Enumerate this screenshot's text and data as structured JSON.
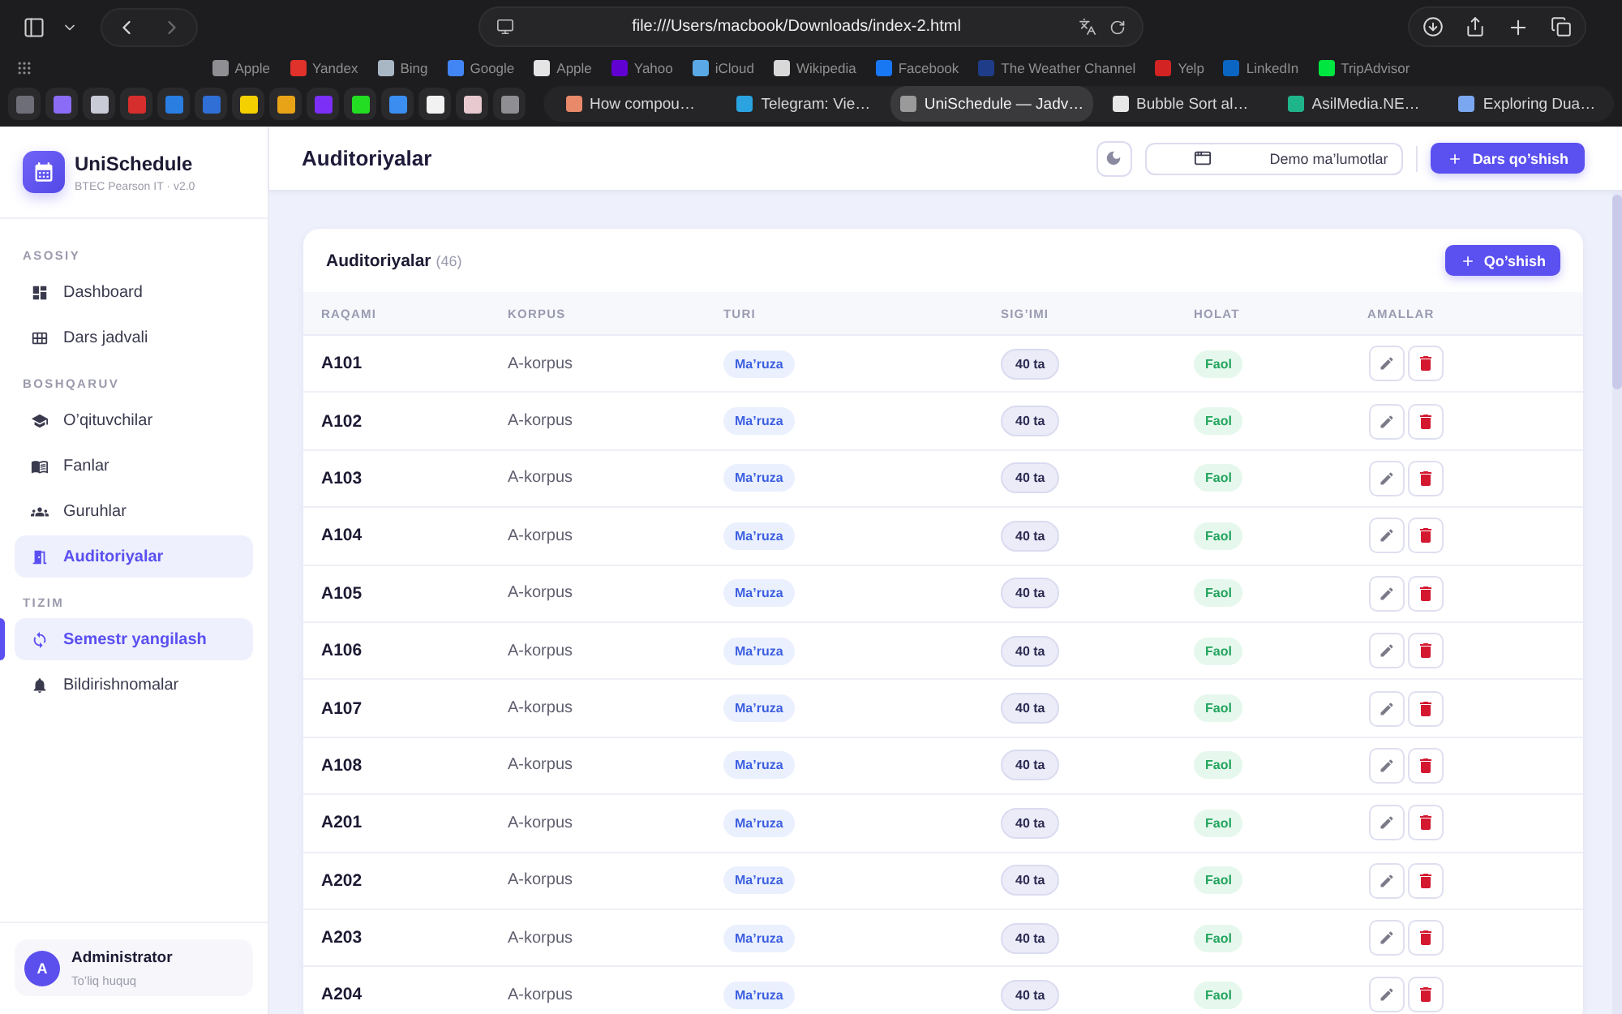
{
  "browser": {
    "url": "file:///Users/macbook/Downloads/index-2.html",
    "bookmarks": [
      {
        "label": "Apple",
        "color": "#8e8e93"
      },
      {
        "label": "Yandex",
        "color": "#e0312b"
      },
      {
        "label": "Bing",
        "color": "#a9b6c4"
      },
      {
        "label": "Google",
        "color": "#4285f4"
      },
      {
        "label": "Apple",
        "color": "#e5e5e5"
      },
      {
        "label": "Yahoo",
        "color": "#6001d2"
      },
      {
        "label": "iCloud",
        "color": "#5aa9e6"
      },
      {
        "label": "Wikipedia",
        "color": "#d9d9d9"
      },
      {
        "label": "Facebook",
        "color": "#1877f2"
      },
      {
        "label": "The Weather Channel",
        "color": "#1f3c88"
      },
      {
        "label": "Yelp",
        "color": "#d32323"
      },
      {
        "label": "LinkedIn",
        "color": "#0a66c2"
      },
      {
        "label": "TripAdvisor",
        "color": "#00e640"
      }
    ],
    "pinned_tabs": [
      {
        "color": "#6e6e78"
      },
      {
        "color": "#8b6cf6"
      },
      {
        "color": "#c9cbd6"
      },
      {
        "color": "#d62d2d"
      },
      {
        "color": "#2a7de1"
      },
      {
        "color": "#2f6fd6"
      },
      {
        "color": "#f5d000"
      },
      {
        "color": "#e8a317"
      },
      {
        "color": "#7b2ff7"
      },
      {
        "color": "#22dd22"
      },
      {
        "color": "#3b8df0"
      },
      {
        "color": "#f2f2f2"
      },
      {
        "color": "#e8c9cf"
      },
      {
        "color": "#8e8e93"
      }
    ],
    "tabs": [
      {
        "title": "How compou…",
        "color": "#e8896a",
        "selected": false
      },
      {
        "title": "Telegram: Vie…",
        "color": "#2aa3e0",
        "selected": false
      },
      {
        "title": "UniSchedule — Jadv…",
        "color": "#9a9a9a",
        "selected": true
      },
      {
        "title": "Bubble Sort al…",
        "color": "#e8e8e8",
        "selected": false
      },
      {
        "title": "AsilMedia.NE…",
        "color": "#1fb58a",
        "selected": false
      },
      {
        "title": "Exploring Dua…",
        "color": "#7aa7f0",
        "selected": false
      }
    ]
  },
  "sidebar": {
    "brand": {
      "name": "UniSchedule",
      "subtitle": "BTEC Pearson IT · v2.0"
    },
    "sections": [
      {
        "title": "ASOSIY",
        "items": [
          {
            "label": "Dashboard",
            "highlighted": false,
            "indicator": false
          },
          {
            "label": "Dars jadvali",
            "highlighted": false,
            "indicator": false
          }
        ]
      },
      {
        "title": "BOSHQARUV",
        "items": [
          {
            "label": "O’qituvchilar",
            "highlighted": false,
            "indicator": false
          },
          {
            "label": "Fanlar",
            "highlighted": false,
            "indicator": false
          },
          {
            "label": "Guruhlar",
            "highlighted": false,
            "indicator": false
          },
          {
            "label": "Auditoriyalar",
            "highlighted": true,
            "indicator": false
          }
        ]
      },
      {
        "title": "TIZIM",
        "items": [
          {
            "label": "Semestr yangilash",
            "highlighted": true,
            "indicator": true
          },
          {
            "label": "Bildirishnomalar",
            "highlighted": false,
            "indicator": false
          }
        ]
      }
    ],
    "user": {
      "initial": "A",
      "name": "Administrator",
      "role": "To’liq huquq"
    }
  },
  "header": {
    "title": "Auditoriyalar",
    "buttons": [
      {
        "label": "Demo ma’lumotlar",
        "kind": "outline"
      },
      {
        "label": "Dars qo’shish",
        "kind": "primary"
      }
    ]
  },
  "rooms_card": {
    "title": "Auditoriyalar",
    "count": "(46)",
    "add_button": "Qo’shish",
    "columns": [
      "RAQAMI",
      "KORPUS",
      "TURI",
      "SIG’IMI",
      "HOLAT",
      "AMALLAR"
    ],
    "rows": [
      {
        "number": "A101",
        "building": "A-korpus",
        "type": "Ma’ruza",
        "capacity": "40 ta",
        "status": "Faol"
      },
      {
        "number": "A102",
        "building": "A-korpus",
        "type": "Ma’ruza",
        "capacity": "40 ta",
        "status": "Faol"
      },
      {
        "number": "A103",
        "building": "A-korpus",
        "type": "Ma’ruza",
        "capacity": "40 ta",
        "status": "Faol"
      },
      {
        "number": "A104",
        "building": "A-korpus",
        "type": "Ma’ruza",
        "capacity": "40 ta",
        "status": "Faol"
      },
      {
        "number": "A105",
        "building": "A-korpus",
        "type": "Ma’ruza",
        "capacity": "40 ta",
        "status": "Faol"
      },
      {
        "number": "A106",
        "building": "A-korpus",
        "type": "Ma’ruza",
        "capacity": "40 ta",
        "status": "Faol"
      },
      {
        "number": "A107",
        "building": "A-korpus",
        "type": "Ma’ruza",
        "capacity": "40 ta",
        "status": "Faol"
      },
      {
        "number": "A108",
        "building": "A-korpus",
        "type": "Ma’ruza",
        "capacity": "40 ta",
        "status": "Faol"
      },
      {
        "number": "A201",
        "building": "A-korpus",
        "type": "Ma’ruza",
        "capacity": "40 ta",
        "status": "Faol"
      },
      {
        "number": "A202",
        "building": "A-korpus",
        "type": "Ma’ruza",
        "capacity": "40 ta",
        "status": "Faol"
      },
      {
        "number": "A203",
        "building": "A-korpus",
        "type": "Ma’ruza",
        "capacity": "40 ta",
        "status": "Faol"
      },
      {
        "number": "A204",
        "building": "A-korpus",
        "type": "Ma’ruza",
        "capacity": "40 ta",
        "status": "Faol"
      }
    ]
  }
}
